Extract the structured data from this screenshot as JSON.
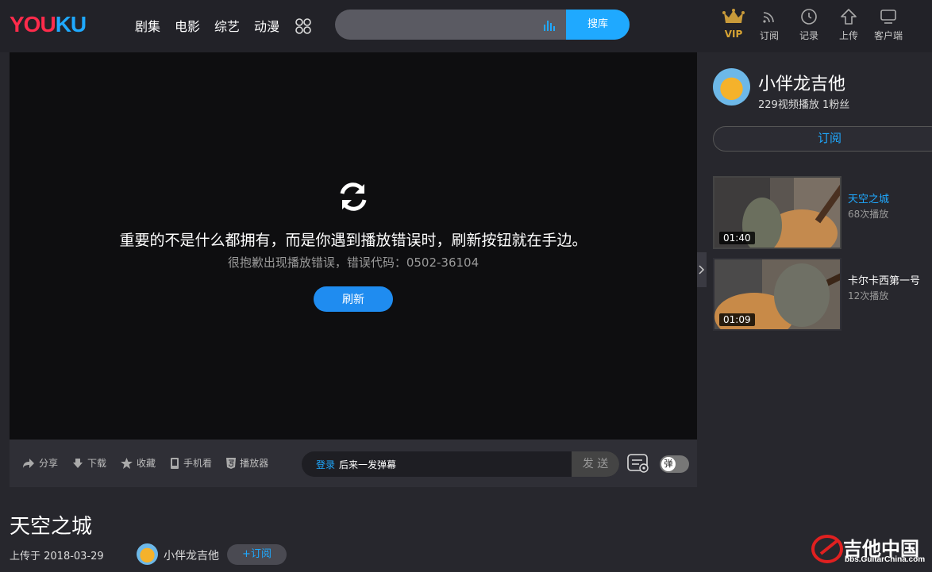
{
  "header": {
    "logo": {
      "part1": "YOU",
      "part2": "KU"
    },
    "nav": [
      "剧集",
      "电影",
      "综艺",
      "动漫"
    ],
    "search": {
      "placeholder": "",
      "button": "搜库"
    },
    "icons": [
      {
        "label": "VIP",
        "icon": "crown-icon"
      },
      {
        "label": "订阅",
        "icon": "rss-icon"
      },
      {
        "label": "记录",
        "icon": "clock-icon"
      },
      {
        "label": "上传",
        "icon": "upload-icon"
      },
      {
        "label": "客户端",
        "icon": "monitor-icon"
      }
    ]
  },
  "player": {
    "error_main": "重要的不是什么都拥有，而是你遇到播放错误时，刷新按钮就在手边。",
    "error_sub": "很抱歉出现播放错误，错误代码：0502-36104",
    "refresh_button": "刷新"
  },
  "player_bar": {
    "items": [
      "分享",
      "下载",
      "收藏",
      "手机看",
      "播放器"
    ],
    "danmu_login": "登录",
    "danmu_rest": "后来一发弹幕",
    "send": "发 送",
    "toggle": "弹"
  },
  "sidebar": {
    "channel_name": "小伴龙吉他",
    "channel_stats": "229视频播放 1粉丝",
    "subscribe": "订阅",
    "related": [
      {
        "title": "天空之城",
        "views": "68次播放",
        "duration": "01:40",
        "active": true
      },
      {
        "title": "卡尔卡西第一号",
        "views": "12次播放",
        "duration": "01:09",
        "active": false
      }
    ]
  },
  "video": {
    "title": "天空之城",
    "upload_date": "上传于 2018-03-29",
    "uploader": "小伴龙吉他",
    "subscribe": "+订阅"
  },
  "watermark": {
    "text": "吉他中国",
    "url": "bbs.GuitarChina.com"
  },
  "colors": {
    "accent": "#1fa9ff",
    "brand_red": "#ff2b4b",
    "vip_gold": "#d8a433"
  }
}
